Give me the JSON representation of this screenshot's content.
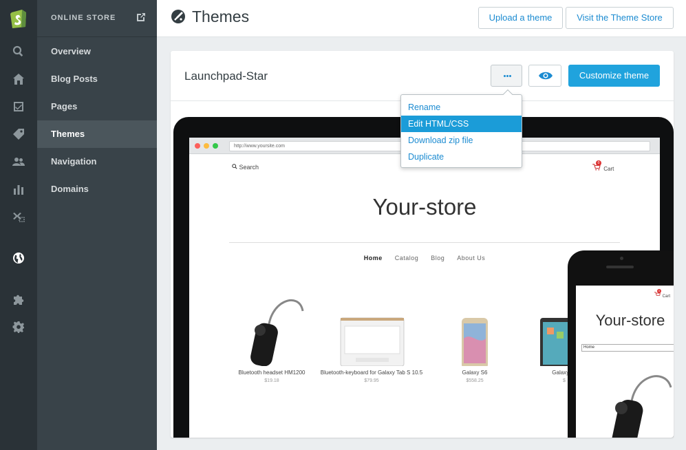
{
  "sidebar": {
    "section_title": "ONLINE STORE",
    "items": [
      {
        "label": "Overview"
      },
      {
        "label": "Blog Posts"
      },
      {
        "label": "Pages"
      },
      {
        "label": "Themes",
        "active": true
      },
      {
        "label": "Navigation"
      },
      {
        "label": "Domains"
      }
    ],
    "rail_icons": [
      "shopify-logo-icon",
      "search-icon",
      "home-icon",
      "orders-icon",
      "tag-icon",
      "customers-icon",
      "reports-icon",
      "discounts-icon",
      "globe-icon",
      "apps-icon",
      "settings-icon"
    ]
  },
  "header": {
    "title": "Themes",
    "upload_label": "Upload a theme",
    "store_label": "Visit the Theme Store"
  },
  "theme_card": {
    "name": "Launchpad-Star",
    "customize_label": "Customize theme"
  },
  "dropdown": {
    "options": [
      {
        "label": "Rename"
      },
      {
        "label": "Edit HTML/CSS",
        "highlighted": true
      },
      {
        "label": "Download zip file"
      },
      {
        "label": "Duplicate"
      }
    ]
  },
  "preview": {
    "url": "http://www.yoursite.com",
    "search_label": "Search",
    "cart_label": "Cart",
    "cart_count": "0",
    "store_title": "Your-store",
    "nav": [
      "Home",
      "Catalog",
      "Blog",
      "About Us"
    ],
    "products": [
      {
        "name": "Bluetooth headset HM1200",
        "price": "$19.18"
      },
      {
        "name": "Bluetooth-keyboard for Galaxy Tab S 10.5",
        "price": "$79.95"
      },
      {
        "name": "Galaxy S6",
        "price": "$558.25"
      },
      {
        "name": "Galaxy Ta",
        "price": "$"
      }
    ],
    "mobile": {
      "store_title": "Your-store",
      "select_value": "Home",
      "cart_label": "Cart",
      "cart_count": "0"
    }
  },
  "colors": {
    "rail_bg": "#2a3237",
    "subnav_bg": "#394349",
    "accent": "#20a3dd",
    "link": "#1b8bd1"
  }
}
